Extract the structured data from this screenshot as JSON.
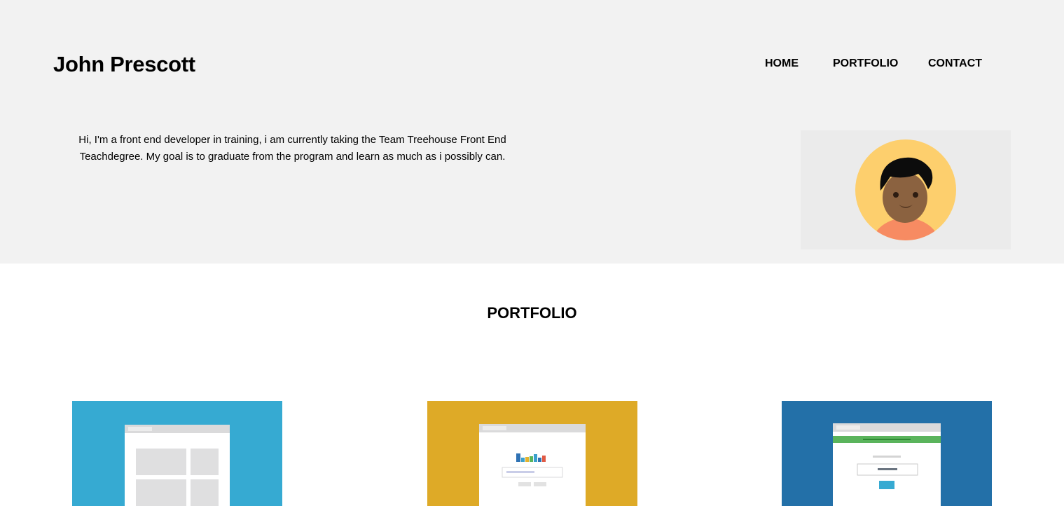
{
  "header": {
    "site_name": "John Prescott",
    "nav": [
      {
        "label": "HOME"
      },
      {
        "label": "PORTFOLIO"
      },
      {
        "label": "CONTACT"
      }
    ]
  },
  "hero": {
    "intro": "Hi, I'm a front end developer in training, i am currently taking the Team Treehouse Front End Teachdegree. My goal is to graduate from the program and learn as much as i possibly can.",
    "avatar": {
      "icon": "user-avatar-illustration"
    }
  },
  "portfolio": {
    "title": "PORTFOLIO",
    "cards": [
      {
        "icon": "grid-layout-thumbnail",
        "color": "#36aad2"
      },
      {
        "icon": "bar-chart-thumbnail",
        "color": "#deaa27"
      },
      {
        "icon": "form-success-thumbnail",
        "color": "#2370a8"
      }
    ]
  }
}
